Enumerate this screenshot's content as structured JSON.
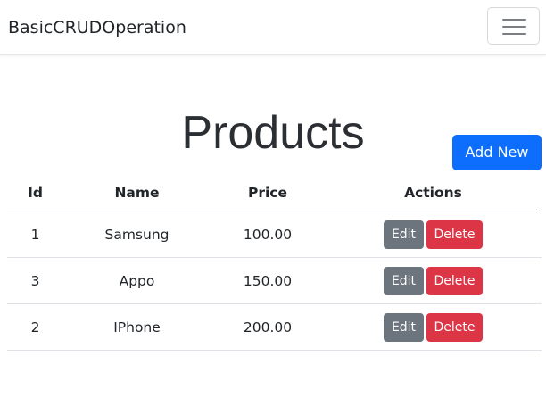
{
  "navbar": {
    "brand": "BasicCRUDOperation"
  },
  "icons": {
    "toggler": "hamburger-menu-icon"
  },
  "page": {
    "title": "Products",
    "add_new_label": "Add New"
  },
  "colors": {
    "primary": "#0d6efd",
    "secondary": "#6c757d",
    "danger": "#dc3545"
  },
  "table": {
    "headers": [
      "Id",
      "Name",
      "Price",
      "Actions"
    ],
    "rows": [
      {
        "id": "1",
        "name": "Samsung",
        "price": "100.00",
        "edit_label": "Edit",
        "delete_label": "Delete"
      },
      {
        "id": "3",
        "name": "Appo",
        "price": "150.00",
        "edit_label": "Edit",
        "delete_label": "Delete"
      },
      {
        "id": "2",
        "name": "IPhone",
        "price": "200.00",
        "edit_label": "Edit",
        "delete_label": "Delete"
      }
    ]
  }
}
